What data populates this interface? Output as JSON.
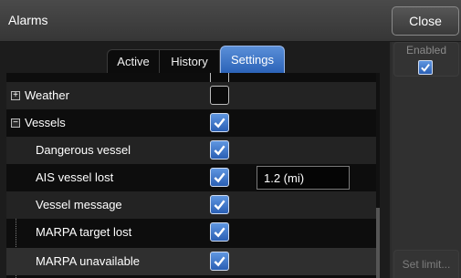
{
  "window": {
    "title": "Alarms",
    "close_label": "Close"
  },
  "tabs": [
    {
      "label": "Active",
      "selected": false
    },
    {
      "label": "History",
      "selected": false
    },
    {
      "label": "Settings",
      "selected": true
    }
  ],
  "list": {
    "rows": [
      {
        "label": "",
        "checked": false,
        "partial": true
      },
      {
        "label": "Weather",
        "expander": "+",
        "checked": false
      },
      {
        "label": "Vessels",
        "expander": "−",
        "checked": true
      },
      {
        "label": "Dangerous vessel",
        "checked": true
      },
      {
        "label": "AIS vessel lost",
        "checked": true,
        "value": "1.2 (mi)"
      },
      {
        "label": "Vessel message",
        "checked": true
      },
      {
        "label": "MARPA target lost",
        "checked": true
      },
      {
        "label": "MARPA unavailable",
        "checked": true,
        "selected": true
      }
    ]
  },
  "side": {
    "enabled_label": "Enabled",
    "enabled_checked": true,
    "set_limit_label": "Set limit..."
  },
  "colors": {
    "accent": "#3a74c8",
    "background": "#2b2b2b",
    "list_background": "#0d0d0d"
  },
  "icons": {
    "checkbox_mark": "checkmark-icon",
    "expand": "plus-icon",
    "collapse": "minus-icon"
  }
}
